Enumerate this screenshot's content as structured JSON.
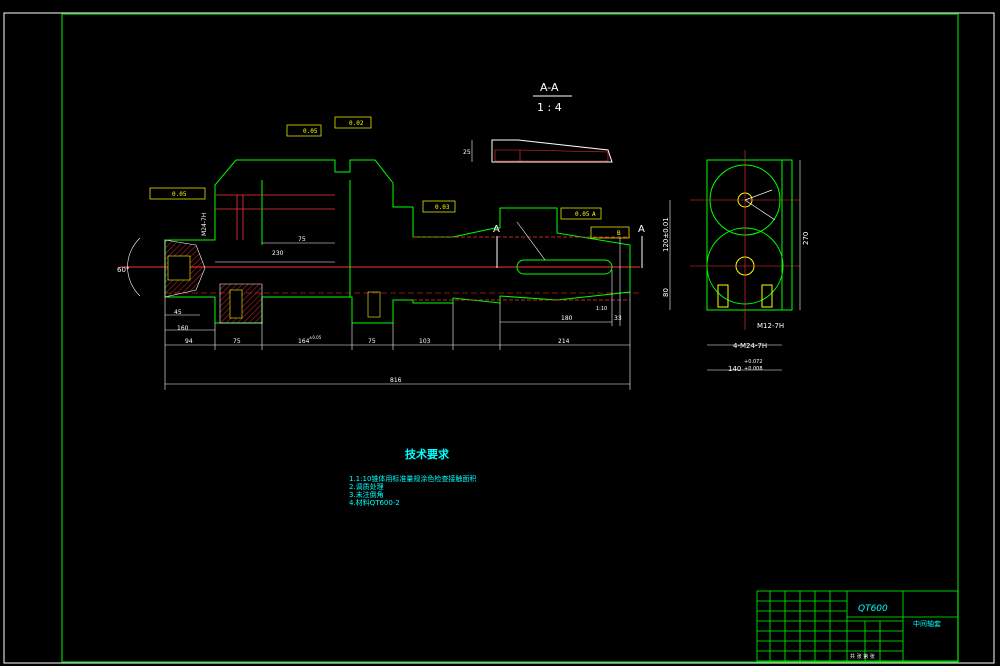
{
  "section_view": {
    "label": "A-A",
    "scale": "1 : 4"
  },
  "section_marker": "A",
  "dimensions": {
    "d_816": "816",
    "d_94": "94",
    "d_75a": "75",
    "d_164": "164",
    "d_164_tol": "±0.05",
    "d_75b": "75",
    "d_103": "103",
    "d_214": "214",
    "d_160": "160",
    "d_45": "45",
    "d_230": "230",
    "d_75c": "75",
    "d_m24": "M24-7H",
    "d_60deg": "60°",
    "d_180": "180",
    "d_33": "33",
    "d_270": "270",
    "d_80": "80",
    "d_120": "120±0.01",
    "d_m12": "M12-7H",
    "d_4m24": "4-M24-7H",
    "d_140": "140",
    "d_140_tol_up": "+0.072",
    "d_140_tol_dn": "+0.008",
    "d_25": "25",
    "d_1_10": "1:10"
  },
  "tolerances": {
    "tol1": "0.05",
    "tol2": "0.02",
    "tol3": "0.05",
    "tol4": "0.03",
    "tol5": "0.05",
    "datum_a": "A",
    "datum_b": "B"
  },
  "notes": {
    "title": "技术要求",
    "items": [
      "1.1:10锥体用标准量规涂色检查接触面积",
      "2.调质处理",
      "3.未注倒角",
      "4.材料QT600-2"
    ]
  },
  "title_block": {
    "material": "QT600",
    "part_name": "中间轴套",
    "scale_row": "共  张   第  张"
  }
}
